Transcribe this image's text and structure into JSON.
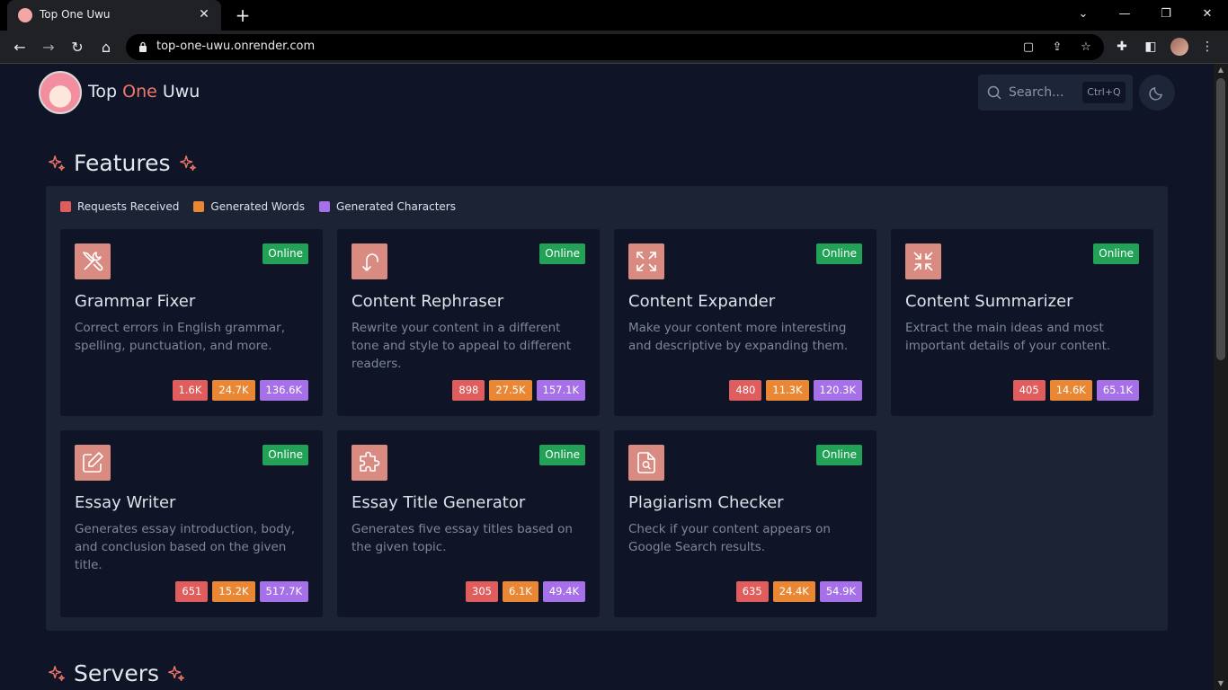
{
  "browser": {
    "tab_title": "Top One Uwu",
    "tab_close": "✕",
    "new_tab": "+",
    "url": "top-one-uwu.onrender.com",
    "window_controls": {
      "dropdown": "⌄",
      "minimize": "—",
      "restore": "❐",
      "close": "✕"
    },
    "nav": {
      "back": "←",
      "forward": "→",
      "reload": "↻",
      "home": "⌂"
    },
    "omnibox_icons": {
      "share_page": "⇪",
      "bookmark": "☆",
      "copy_page": "▢"
    },
    "toolbar_icons": {
      "extensions": "✚",
      "side_panel": "◧",
      "menu": "⋮"
    }
  },
  "header": {
    "brand_part1": "Top",
    "brand_part2": "One",
    "brand_part3": "Uwu",
    "search_placeholder": "Search...",
    "search_shortcut": "Ctrl+Q"
  },
  "sections": {
    "features": "Features",
    "servers": "Servers"
  },
  "legend": [
    {
      "label": "Requests Received",
      "color": "#e05d5d"
    },
    {
      "label": "Generated Words",
      "color": "#e98735"
    },
    {
      "label": "Generated Characters",
      "color": "#a670e8"
    }
  ],
  "features": [
    {
      "title": "Grammar Fixer",
      "status": "Online",
      "icon": "tools-icon",
      "description": "Correct errors in English grammar, spelling, punctuation, and more.",
      "requests": "1.6K",
      "words": "24.7K",
      "chars": "136.6K"
    },
    {
      "title": "Content Rephraser",
      "status": "Online",
      "icon": "rephrase-arrow-icon",
      "description": "Rewrite your content in a different tone and style to appeal to different readers.",
      "requests": "898",
      "words": "27.5K",
      "chars": "157.1K"
    },
    {
      "title": "Content Expander",
      "status": "Online",
      "icon": "expand-icon",
      "description": "Make your content more interesting and descriptive by expanding them.",
      "requests": "480",
      "words": "11.3K",
      "chars": "120.3K"
    },
    {
      "title": "Content Summarizer",
      "status": "Online",
      "icon": "shrink-icon",
      "description": "Extract the main ideas and most important details of your content.",
      "requests": "405",
      "words": "14.6K",
      "chars": "65.1K"
    },
    {
      "title": "Essay Writer",
      "status": "Online",
      "icon": "pencil-square-icon",
      "description": "Generates essay introduction, body, and conclusion based on the given title.",
      "requests": "651",
      "words": "15.2K",
      "chars": "517.7K"
    },
    {
      "title": "Essay Title Generator",
      "status": "Online",
      "icon": "puzzle-icon",
      "description": "Generates five essay titles based on the given topic.",
      "requests": "305",
      "words": "6.1K",
      "chars": "49.4K"
    },
    {
      "title": "Plagiarism Checker",
      "status": "Online",
      "icon": "document-search-icon",
      "description": "Check if your content appears on Google Search results.",
      "requests": "635",
      "words": "24.4K",
      "chars": "54.9K"
    }
  ]
}
